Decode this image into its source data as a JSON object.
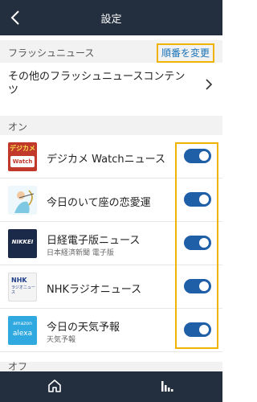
{
  "header": {
    "title": "設定",
    "back_icon": "chevron-left-icon"
  },
  "flash_section": {
    "label": "フラッシュニュース",
    "reorder_label": "順番を変更"
  },
  "other_content": {
    "label": "その他のフラッシュニュースコンテンツ"
  },
  "on_section": {
    "label": "オン"
  },
  "items": [
    {
      "name": "デジカメ Watchニュース",
      "sub": "",
      "enabled": true,
      "logo_text_1": "デジカメ",
      "logo_text_2": "Watch"
    },
    {
      "name": "今日のいて座の恋愛運",
      "sub": "",
      "enabled": true
    },
    {
      "name": "日経電子版ニュース",
      "sub": "日本経済新聞 電子版",
      "enabled": true,
      "logo_text_1": "NIKKEI"
    },
    {
      "name": "NHKラジオニュース",
      "sub": "",
      "enabled": true,
      "logo_text_1": "NHK",
      "logo_text_2": "ラジオニュース"
    },
    {
      "name": "今日の天気予報",
      "sub": "天気予報",
      "enabled": true,
      "logo_text_1": "amazon",
      "logo_text_2": "alexa"
    }
  ],
  "off_section": {
    "label": "オフ"
  },
  "nav": {
    "home_icon": "home-icon",
    "activity_icon": "bars-icon"
  },
  "colors": {
    "topbar": "#232f3e",
    "toggle_on": "#1f5fa8",
    "highlight": "#f0b400",
    "link": "#1a73b8"
  }
}
